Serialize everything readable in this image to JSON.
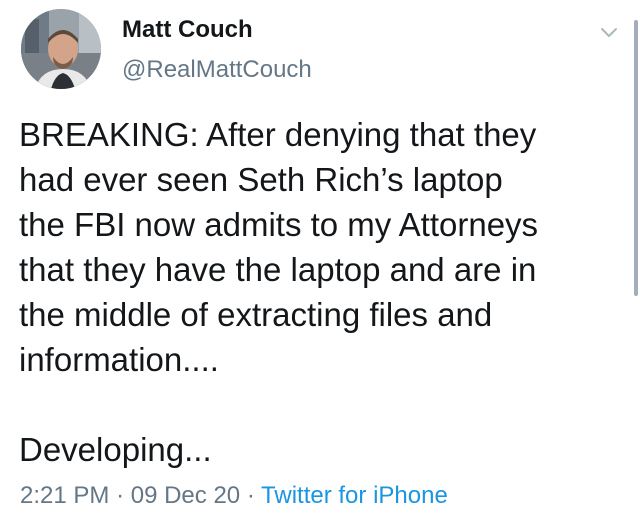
{
  "tweet": {
    "display_name": "Matt Couch",
    "handle": "@RealMattCouch",
    "text_lines": [
      "BREAKING: After denying that they",
      "had ever seen Seth Rich’s laptop",
      "the FBI now admits to my Attorneys",
      "that they have the laptop and are in",
      "the middle of extracting files and",
      "information...."
    ],
    "closing_line": "Developing...",
    "time": "2:21 PM",
    "separator": "·",
    "date": "09 Dec 20",
    "source": "Twitter for iPhone"
  },
  "icons": {
    "menu": "chevron-down-icon",
    "avatar": "profile-photo"
  },
  "colors": {
    "text": "#14171a",
    "secondary": "#657786",
    "link": "#1b95e0"
  }
}
